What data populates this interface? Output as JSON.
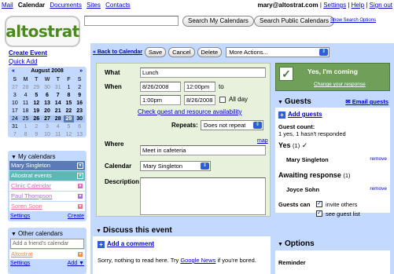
{
  "topnav": {
    "items": [
      "Mail",
      "Calendar",
      "Documents",
      "Sites",
      "Contacts"
    ],
    "account_email": "mary@altostrat.com",
    "links": [
      "Settings",
      "Help",
      "Sign out"
    ]
  },
  "logo": {
    "text": "altostrat"
  },
  "search": {
    "my_button": "Search My Calendars",
    "public_button": "Search Public Calendars",
    "options_link": "Show Search Options"
  },
  "sidebar": {
    "create_event": "Create Event",
    "quick_add": "Quick Add",
    "minical": {
      "prev": "«",
      "month": "August 2008",
      "next": "»",
      "day_headers": [
        "S",
        "M",
        "T",
        "W",
        "T",
        "F",
        "S"
      ],
      "weeks": [
        [
          "27",
          "28",
          "29",
          "30",
          "31",
          "1",
          "2"
        ],
        [
          "3",
          "4",
          "5",
          "6",
          "7",
          "8",
          "9"
        ],
        [
          "10",
          "11",
          "12",
          "13",
          "14",
          "15",
          "16"
        ],
        [
          "17",
          "18",
          "19",
          "20",
          "21",
          "22",
          "23"
        ],
        [
          "24",
          "25",
          "26",
          "27",
          "28",
          "29",
          "30"
        ],
        [
          "31",
          "1",
          "2",
          "3",
          "4",
          "5",
          "6"
        ],
        [
          "7",
          "8",
          "9",
          "10",
          "11",
          "12",
          "13"
        ]
      ]
    },
    "my_calendars": {
      "title": "My calendars",
      "items": [
        {
          "label": "Mary Singleton",
          "selected": true,
          "color": "#5b7ab8"
        },
        {
          "label": "Altostrat events",
          "selected": true,
          "color": "#5cb8b2"
        },
        {
          "label": "Clinic Calendar",
          "selected": false,
          "color": "#e067b6"
        },
        {
          "label": "Paul Thompson",
          "selected": false,
          "color": "#a86bd1"
        },
        {
          "label": "Soren Soon",
          "selected": false,
          "color": "#e67399"
        }
      ],
      "settings": "Settings",
      "create": "Create"
    },
    "other_calendars": {
      "title": "Other calendars",
      "add_placeholder": "Add a friend's calendar",
      "items": [
        {
          "label": "Altostrat",
          "color": "#f08a4b"
        }
      ],
      "settings": "Settings",
      "add": "Add"
    }
  },
  "toolbar": {
    "back": "« Back to Calendar",
    "save": "Save",
    "cancel": "Cancel",
    "delete": "Delete",
    "more_actions": "More Actions..."
  },
  "event": {
    "what_label": "What",
    "what_value": "Lunch",
    "when_label": "When",
    "start_date": "8/26/2008",
    "start_time": "12:00pm",
    "to": "to",
    "end_time": "1:00pm",
    "end_date": "8/26/2008",
    "all_day": "All day",
    "check_avail": "Check guest and resource availability",
    "repeats_label": "Repeats:",
    "repeats_value": "Does not repeat",
    "where_label": "Where",
    "map": "map",
    "where_value": "Meet in cafeteria",
    "calendar_label": "Calendar",
    "calendar_value": "Mary Singleton",
    "description_label": "Description"
  },
  "discuss": {
    "title": "Discuss this event",
    "add_comment": "Add a comment",
    "sorry_pre": "Sorry, nothing to read here. Try ",
    "sorry_link": "Google News",
    "sorry_post": " if you're bored."
  },
  "rsvp": {
    "status": "Yes, I'm coming",
    "change": "Change your response"
  },
  "guests": {
    "title": "Guests",
    "email_link": "Email guests",
    "add_link": "Add guests",
    "count_label": "Guest count:",
    "count_text": "1 yes, 1 hasn't responded",
    "yes_heading": "Yes",
    "yes_count": "(1)",
    "yes_list": [
      {
        "name": "Mary Singleton",
        "remove": "remove"
      }
    ],
    "awaiting_heading": "Awaiting response",
    "awaiting_count": "(1)",
    "awaiting_list": [
      {
        "name": "Joyce Sohn",
        "remove": "remove"
      }
    ],
    "can_label": "Guests can",
    "perm_invite": "invite others",
    "perm_see": "see guest list"
  },
  "options": {
    "title": "Options",
    "reminder": "Reminder"
  },
  "colors": {
    "panel_blue": "#c3d9ff",
    "detail_green": "#e8f1dc",
    "rsvp_green": "#6f9f59",
    "link": "#0000cc",
    "logo_green": "#4a8a1c"
  }
}
